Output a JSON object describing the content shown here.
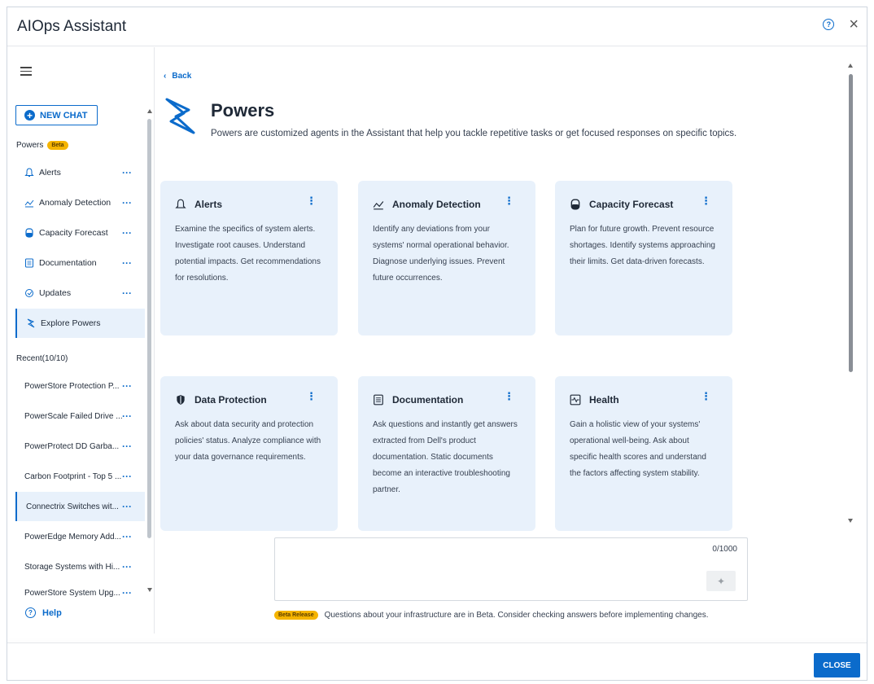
{
  "app": {
    "title": "AIOps Assistant"
  },
  "sidebar": {
    "new_chat_label": "NEW CHAT",
    "powers_label": "Powers",
    "beta_label": "Beta",
    "items": [
      {
        "label": "Alerts",
        "icon": "bell-icon"
      },
      {
        "label": "Anomaly Detection",
        "icon": "chart-icon"
      },
      {
        "label": "Capacity Forecast",
        "icon": "database-icon"
      },
      {
        "label": "Documentation",
        "icon": "document-icon"
      },
      {
        "label": "Updates",
        "icon": "refresh-icon"
      },
      {
        "label": "Explore Powers",
        "icon": "lightning-icon"
      }
    ],
    "recent_label": "Recent(10/10)",
    "recent": [
      "PowerStore Protection P...",
      "PowerScale Failed Drive ...",
      "PowerProtect DD Garba...",
      "Carbon Footprint - Top 5 ...",
      "Connectrix Switches wit...",
      "PowerEdge Memory Add...",
      "Storage Systems with Hi...",
      "PowerStore System Upg..."
    ],
    "more_label": "···",
    "help_label": "Help"
  },
  "main": {
    "back_label": "Back",
    "title": "Powers",
    "subtitle": "Powers are customized agents in the Assistant that help you tackle repetitive tasks or get focused responses on specific topics.",
    "cards": [
      {
        "title": "Alerts",
        "icon": "bell-icon",
        "desc": "Examine the specifics of system alerts. Investigate root causes. Understand potential impacts. Get recommendations for resolutions."
      },
      {
        "title": "Anomaly Detection",
        "icon": "chart-icon",
        "desc": "Identify any deviations from your systems' normal operational behavior. Diagnose underlying issues. Prevent future occurrences."
      },
      {
        "title": "Capacity Forecast",
        "icon": "database-icon",
        "desc": "Plan for future growth. Prevent resource shortages. Identify systems approaching their limits. Get data-driven forecasts."
      },
      {
        "title": "Data Protection",
        "icon": "shield-icon",
        "desc": "Ask about data security and protection policies' status. Analyze compliance with your data governance requirements."
      },
      {
        "title": "Documentation",
        "icon": "document-icon",
        "desc": "Ask questions and instantly get answers extracted from Dell's product documentation. Static documents become an interactive troubleshooting partner."
      },
      {
        "title": "Health",
        "icon": "heartbeat-icon",
        "desc": "Gain a holistic view of your systems' operational well-being. Ask about specific health scores and understand the factors affecting system stability."
      }
    ],
    "composer": {
      "counter": "0/1000"
    },
    "disclaimer_badge": "Beta Release",
    "disclaimer_text": "Questions about your infrastructure are in Beta. Consider checking answers before implementing changes."
  },
  "footer": {
    "close_label": "CLOSE"
  },
  "colors": {
    "accent": "#0b6bcb",
    "card_bg": "#e8f1fb",
    "beta": "#f5b400"
  }
}
